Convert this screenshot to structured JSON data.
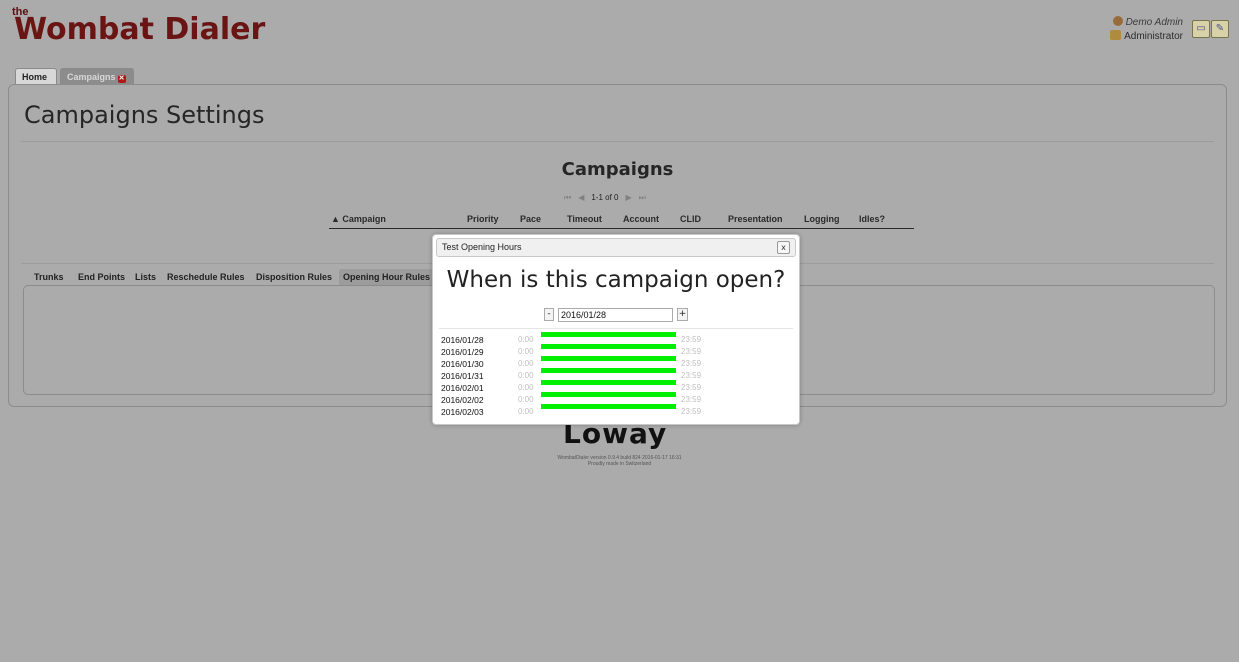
{
  "header": {
    "logo_the": "the",
    "logo_text": "Wombat Dialer",
    "user_name": "Demo Admin",
    "user_role": "Administrator"
  },
  "tabs": [
    {
      "label": "Home"
    },
    {
      "label": "Campaigns"
    }
  ],
  "page": {
    "title": "Campaigns Settings",
    "table_heading": "Campaigns",
    "pager_text": "1-1 of 0",
    "columns": [
      "▲ Campaign",
      "Priority",
      "Pace",
      "Timeout",
      "Account",
      "CLID",
      "Presentation",
      "Logging",
      "Idles?"
    ]
  },
  "subtabs": [
    "Trunks",
    "End Points",
    "Lists",
    "Reschedule Rules",
    "Disposition Rules",
    "Opening Hour Rules"
  ],
  "footer": {
    "logo": "Loway",
    "version": "WombatDialer version 0.9.4 build 824 2016-01-17 16:31",
    "tagline": "Proudly made in Switzerland"
  },
  "dialog": {
    "title": "Test Opening Hours",
    "close_label": "x",
    "heading": "When is this campaign open?",
    "minus_label": "-",
    "plus_label": "+",
    "date_value": "2016/01/28",
    "rows": [
      {
        "date": "2016/01/28",
        "start": "0:00",
        "end": "23:59",
        "open_fraction": 1.0
      },
      {
        "date": "2016/01/29",
        "start": "0:00",
        "end": "23:59",
        "open_fraction": 1.0
      },
      {
        "date": "2016/01/30",
        "start": "0:00",
        "end": "23:59",
        "open_fraction": 1.0
      },
      {
        "date": "2016/01/31",
        "start": "0:00",
        "end": "23:59",
        "open_fraction": 1.0
      },
      {
        "date": "2016/02/01",
        "start": "0:00",
        "end": "23:59",
        "open_fraction": 1.0
      },
      {
        "date": "2016/02/02",
        "start": "0:00",
        "end": "23:59",
        "open_fraction": 1.0
      },
      {
        "date": "2016/02/03",
        "start": "0:00",
        "end": "23:59",
        "open_fraction": 1.0
      }
    ]
  },
  "colors": {
    "overlay": "#ababab",
    "bar_open": "#00ee00",
    "logo": "#6a1414"
  }
}
